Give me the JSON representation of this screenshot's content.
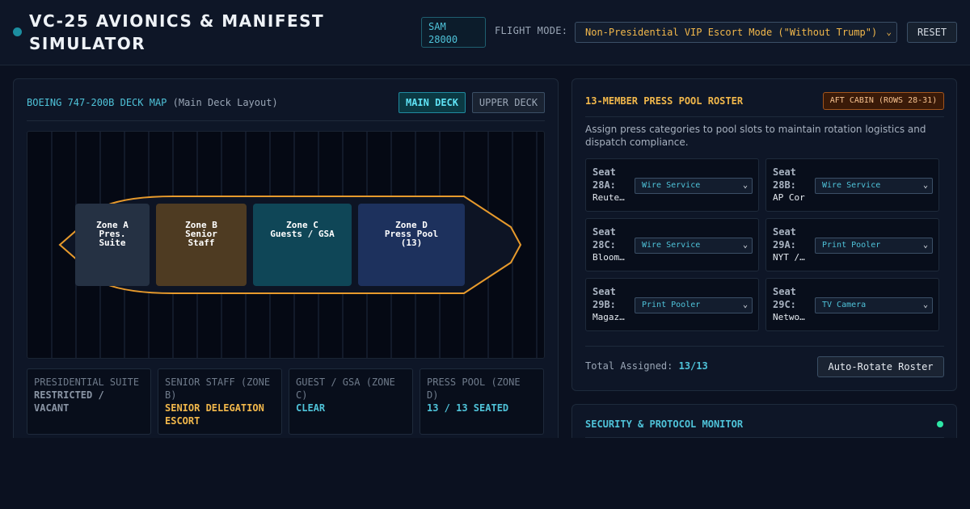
{
  "header": {
    "title": "VC-25 AVIONICS & MANIFEST SIMULATOR",
    "callsign_badge": "SAM 28000",
    "mode_label": "FLIGHT MODE:",
    "mode_value": "Non-Presidential VIP Escort Mode (\"Without Trump\")",
    "reset_label": "RESET"
  },
  "deck": {
    "title": "BOEING 747-200B DECK MAP",
    "subtitle": "(Main Deck Layout)",
    "tabs": [
      "MAIN DECK",
      "UPPER DECK"
    ],
    "active_tab": "MAIN DECK",
    "zones": [
      {
        "label": "Zone A\nPres.\nSuite",
        "color": "#253143"
      },
      {
        "label": "Zone B\nSenior\nStaff",
        "color": "#4e3b22"
      },
      {
        "label": "Zone C\nGuests / GSA",
        "color": "#0f4657"
      },
      {
        "label": "Zone D\nPress Pool\n(13)",
        "color": "#1d315d"
      }
    ],
    "zone_status": [
      {
        "title": "PRESIDENTIAL SUITE",
        "status": "RESTRICTED / VACANT"
      },
      {
        "title": "SENIOR STAFF (ZONE B)",
        "status": "SENIOR DELEGATION ESCORT"
      },
      {
        "title": "GUEST / GSA (ZONE C)",
        "status": "CLEAR"
      },
      {
        "title": "PRESS POOL (ZONE D)",
        "status": "13 / 13 SEATED"
      }
    ]
  },
  "roster": {
    "title": "13-MEMBER PRESS POOL ROSTER",
    "badge": "AFT CABIN (ROWS 28-31)",
    "description": "Assign press categories to pool slots to maintain rotation logistics and dispatch compliance.",
    "seats": [
      {
        "seat": "Seat\n28A:",
        "outlet": "Reuters",
        "category": "Wire Service"
      },
      {
        "seat": "Seat\n28B:",
        "outlet": "AP Cor",
        "category": "Wire Service"
      },
      {
        "seat": "Seat\n28C:",
        "outlet": "Bloomberg",
        "category": "Wire Service"
      },
      {
        "seat": "Seat\n29A:",
        "outlet": "NYT / WSJ",
        "category": "Print Pooler"
      },
      {
        "seat": "Seat\n29B:",
        "outlet": "Magazine",
        "category": "Print Pooler"
      },
      {
        "seat": "Seat\n29C:",
        "outlet": "Network",
        "category": "TV Camera"
      }
    ],
    "total_label": "Total Assigned:",
    "total_value": "13/13",
    "rotate_label": "Auto-Rotate Roster"
  },
  "security": {
    "title": "SECURITY & PROTOCOL MONITOR",
    "status_color": "#2ee6a6"
  },
  "colors": {
    "accent_cyan": "#4fc3d9",
    "accent_amber": "#f2b84b",
    "background": "#0b1120"
  }
}
